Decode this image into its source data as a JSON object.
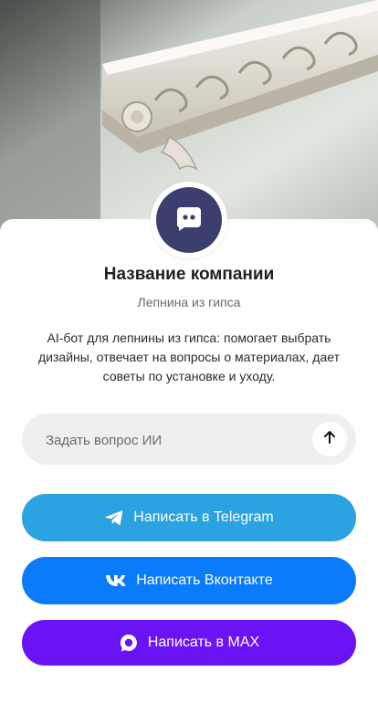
{
  "company": {
    "name": "Название компании",
    "category": "Лепнина из гипса",
    "description": "AI-бот для лепнины из гипса: помогает выбрать дизайны, отвечает на вопросы о материалах, дает советы по установке и уходу."
  },
  "ask": {
    "placeholder": "Задать вопрос ИИ"
  },
  "buttons": {
    "telegram": "Написать в Telegram",
    "vk": "Написать Вконтакте",
    "max": "Написать в MAX"
  },
  "colors": {
    "avatar": "#3c3f6e",
    "telegram": "#2aa3e0",
    "vk": "#0a7bfb",
    "max": "#6a14f5"
  },
  "icons": {
    "avatar": "chat-bot-icon",
    "send": "arrow-up-icon",
    "telegram": "telegram-icon",
    "vk": "vk-icon",
    "max": "max-chat-icon"
  }
}
